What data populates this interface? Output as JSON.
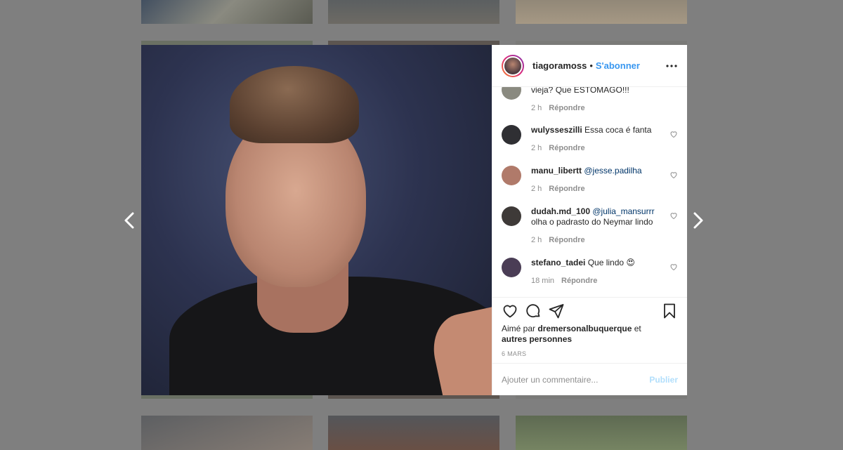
{
  "post": {
    "username": "tiagoramoss",
    "separator": "•",
    "follow_label": "S'abonner",
    "more_icon": "more-horizontal-icon"
  },
  "comments": [
    {
      "username": "",
      "text": "vieja? Que ESTOMAGO!!!",
      "mention": "",
      "time": "2 h",
      "reply_label": "Répondre",
      "avatar_color": "#8a8a80"
    },
    {
      "username": "wulysseszilli",
      "text": "Essa coca é fanta",
      "mention": "",
      "time": "2 h",
      "reply_label": "Répondre",
      "avatar_color": "#2f2f33"
    },
    {
      "username": "manu_libertt",
      "text": "",
      "mention": "@jesse.padilha",
      "time": "2 h",
      "reply_label": "Répondre",
      "avatar_color": "#b07a6a"
    },
    {
      "username": "dudah.md_100",
      "mention": "@julia_mansurrr",
      "text": "olha o padrasto do Neymar lindo",
      "time": "2 h",
      "reply_label": "Répondre",
      "avatar_color": "#3e3a38"
    },
    {
      "username": "stefano_tadei",
      "text": "Que lindo 😍",
      "mention": "",
      "time": "18 min",
      "reply_label": "Répondre",
      "avatar_color": "#4a3d55"
    }
  ],
  "likes": {
    "prefix": "Aimé par",
    "user": "dremersonalbuquerque",
    "joiner": "et",
    "others": "autres personnes"
  },
  "date": "6 MARS",
  "comment_box": {
    "placeholder": "Ajouter un commentaire...",
    "post_label": "Publier"
  },
  "colors": {
    "link": "#3897f0",
    "mention": "#003569",
    "muted": "#8e8e8e",
    "post_disabled": "#b2dffc"
  }
}
